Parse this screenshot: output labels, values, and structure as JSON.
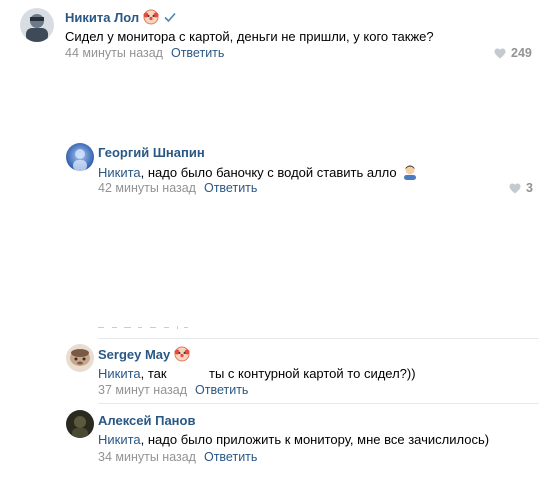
{
  "comments": [
    {
      "name": "Никита Лол",
      "text": "Сидел у монитора с картой, деньги не пришли, у кого также?",
      "time": "44 минуты назад",
      "reply": "Ответить",
      "likes": "249",
      "avatar_color": "#6b7a8a"
    },
    {
      "name": "Георгий Шнапин",
      "mention": "Никита",
      "text": ", надо было баночку с водой ставить алло",
      "time": "42 минуты назад",
      "reply": "Ответить",
      "likes": "3",
      "avatar_color": "#2f5fb3"
    },
    {
      "name": "Sergey May",
      "mention": "Никита",
      "text_part1": ", так",
      "text_part2": "ты с контурной картой то сидел?))",
      "time": "37 минут назад",
      "reply": "Ответить",
      "avatar_color": "#c8a68a"
    },
    {
      "name": "Алексей Панов",
      "mention": "Никита",
      "text": ", надо было приложить к монитору, мне все зачислилось)",
      "time": "34 минуты назад",
      "reply": "Ответить",
      "avatar_color": "#3a3a2a"
    }
  ],
  "icons": {
    "heart": "heart-icon",
    "verified": "verified-check-icon",
    "clown": "clown-badge-icon"
  },
  "colors": {
    "link": "#2a5885",
    "muted": "#939393",
    "separator": "#e7e8ec"
  }
}
